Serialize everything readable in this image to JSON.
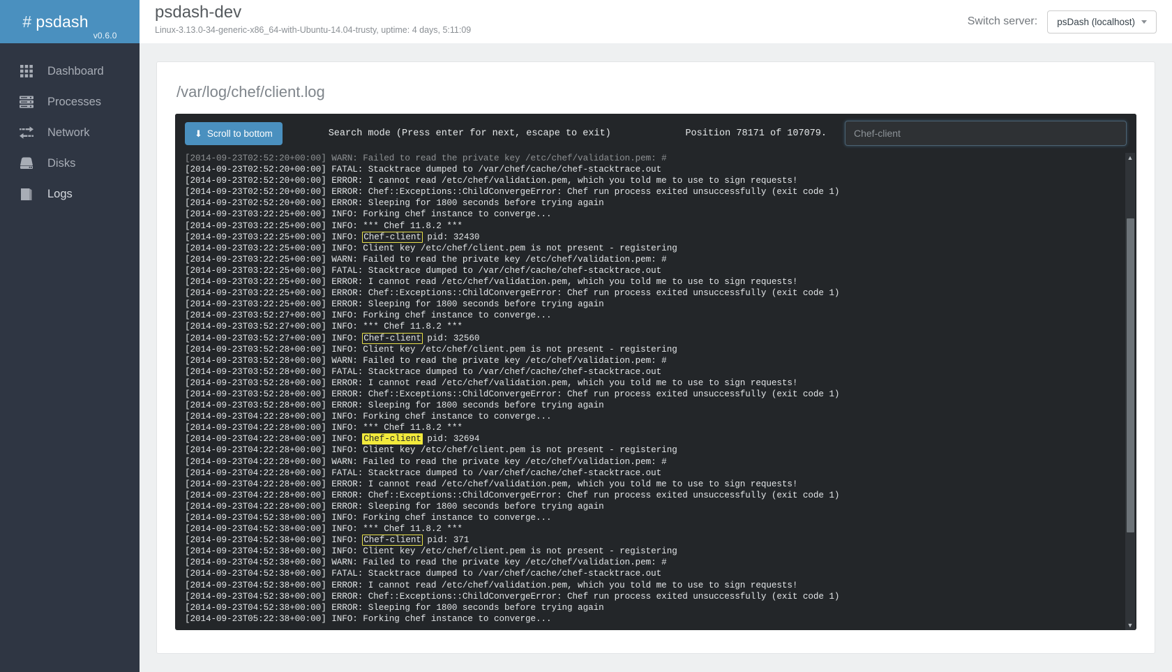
{
  "brand": {
    "hash": "#",
    "name": "psdash",
    "version": "v0.6.0"
  },
  "header": {
    "hostname": "psdash-dev",
    "meta": "Linux-3.13.0-34-generic-x86_64-with-Ubuntu-14.04-trusty, uptime: 4 days, 5:11:09",
    "switch_label": "Switch server:",
    "switch_value": "psDash (localhost)"
  },
  "sidebar": {
    "items": [
      {
        "label": "Dashboard",
        "icon": "grid-icon",
        "active": false
      },
      {
        "label": "Processes",
        "icon": "list-icon",
        "active": false
      },
      {
        "label": "Network",
        "icon": "network-arrows-icon",
        "active": false
      },
      {
        "label": "Disks",
        "icon": "disk-icon",
        "active": false
      },
      {
        "label": "Logs",
        "icon": "book-icon",
        "active": true
      }
    ]
  },
  "log": {
    "path": "/var/log/chef/client.log",
    "scroll_button": "Scroll to bottom",
    "scroll_icon": "arrow-down-icon",
    "search_mode": "Search mode (Press enter for next, escape to exit)",
    "position": "Position 78171 of 107079.",
    "search_value": "Chef-client",
    "search_placeholder": "Chef-client",
    "highlight_term": "Chef-client",
    "current_match_index": 2,
    "lines": [
      "[2014-09-23T02:52:20+00:00] WARN: Failed to read the private key /etc/chef/validation.pem: #",
      "[2014-09-23T02:52:20+00:00] FATAL: Stacktrace dumped to /var/chef/cache/chef-stacktrace.out",
      "[2014-09-23T02:52:20+00:00] ERROR: I cannot read /etc/chef/validation.pem, which you told me to use to sign requests!",
      "[2014-09-23T02:52:20+00:00] ERROR: Chef::Exceptions::ChildConvergeError: Chef run process exited unsuccessfully (exit code 1)",
      "[2014-09-23T02:52:20+00:00] ERROR: Sleeping for 1800 seconds before trying again",
      "[2014-09-23T03:22:25+00:00] INFO: Forking chef instance to converge...",
      "[2014-09-23T03:22:25+00:00] INFO: *** Chef 11.8.2 ***",
      "[2014-09-23T03:22:25+00:00] INFO: Chef-client pid: 32430",
      "[2014-09-23T03:22:25+00:00] INFO: Client key /etc/chef/client.pem is not present - registering",
      "[2014-09-23T03:22:25+00:00] WARN: Failed to read the private key /etc/chef/validation.pem: #",
      "[2014-09-23T03:22:25+00:00] FATAL: Stacktrace dumped to /var/chef/cache/chef-stacktrace.out",
      "[2014-09-23T03:22:25+00:00] ERROR: I cannot read /etc/chef/validation.pem, which you told me to use to sign requests!",
      "[2014-09-23T03:22:25+00:00] ERROR: Chef::Exceptions::ChildConvergeError: Chef run process exited unsuccessfully (exit code 1)",
      "[2014-09-23T03:22:25+00:00] ERROR: Sleeping for 1800 seconds before trying again",
      "[2014-09-23T03:52:27+00:00] INFO: Forking chef instance to converge...",
      "[2014-09-23T03:52:27+00:00] INFO: *** Chef 11.8.2 ***",
      "[2014-09-23T03:52:27+00:00] INFO: Chef-client pid: 32560",
      "[2014-09-23T03:52:28+00:00] INFO: Client key /etc/chef/client.pem is not present - registering",
      "[2014-09-23T03:52:28+00:00] WARN: Failed to read the private key /etc/chef/validation.pem: #",
      "[2014-09-23T03:52:28+00:00] FATAL: Stacktrace dumped to /var/chef/cache/chef-stacktrace.out",
      "[2014-09-23T03:52:28+00:00] ERROR: I cannot read /etc/chef/validation.pem, which you told me to use to sign requests!",
      "[2014-09-23T03:52:28+00:00] ERROR: Chef::Exceptions::ChildConvergeError: Chef run process exited unsuccessfully (exit code 1)",
      "[2014-09-23T03:52:28+00:00] ERROR: Sleeping for 1800 seconds before trying again",
      "[2014-09-23T04:22:28+00:00] INFO: Forking chef instance to converge...",
      "[2014-09-23T04:22:28+00:00] INFO: *** Chef 11.8.2 ***",
      "[2014-09-23T04:22:28+00:00] INFO: Chef-client pid: 32694",
      "[2014-09-23T04:22:28+00:00] INFO: Client key /etc/chef/client.pem is not present - registering",
      "[2014-09-23T04:22:28+00:00] WARN: Failed to read the private key /etc/chef/validation.pem: #",
      "[2014-09-23T04:22:28+00:00] FATAL: Stacktrace dumped to /var/chef/cache/chef-stacktrace.out",
      "[2014-09-23T04:22:28+00:00] ERROR: I cannot read /etc/chef/validation.pem, which you told me to use to sign requests!",
      "[2014-09-23T04:22:28+00:00] ERROR: Chef::Exceptions::ChildConvergeError: Chef run process exited unsuccessfully (exit code 1)",
      "[2014-09-23T04:22:28+00:00] ERROR: Sleeping for 1800 seconds before trying again",
      "[2014-09-23T04:52:38+00:00] INFO: Forking chef instance to converge...",
      "[2014-09-23T04:52:38+00:00] INFO: *** Chef 11.8.2 ***",
      "[2014-09-23T04:52:38+00:00] INFO: Chef-client pid: 371",
      "[2014-09-23T04:52:38+00:00] INFO: Client key /etc/chef/client.pem is not present - registering",
      "[2014-09-23T04:52:38+00:00] WARN: Failed to read the private key /etc/chef/validation.pem: #",
      "[2014-09-23T04:52:38+00:00] FATAL: Stacktrace dumped to /var/chef/cache/chef-stacktrace.out",
      "[2014-09-23T04:52:38+00:00] ERROR: I cannot read /etc/chef/validation.pem, which you told me to use to sign requests!",
      "[2014-09-23T04:52:38+00:00] ERROR: Chef::Exceptions::ChildConvergeError: Chef run process exited unsuccessfully (exit code 1)",
      "[2014-09-23T04:52:38+00:00] ERROR: Sleeping for 1800 seconds before trying again",
      "[2014-09-23T05:22:38+00:00] INFO: Forking chef instance to converge..."
    ]
  },
  "colors": {
    "brand_blue": "#4a90bf",
    "sidebar_dark": "#2f3643",
    "viewer_bg": "#232629",
    "highlight_yellow": "#f2ea3c",
    "content_bg": "#eef0f1"
  }
}
